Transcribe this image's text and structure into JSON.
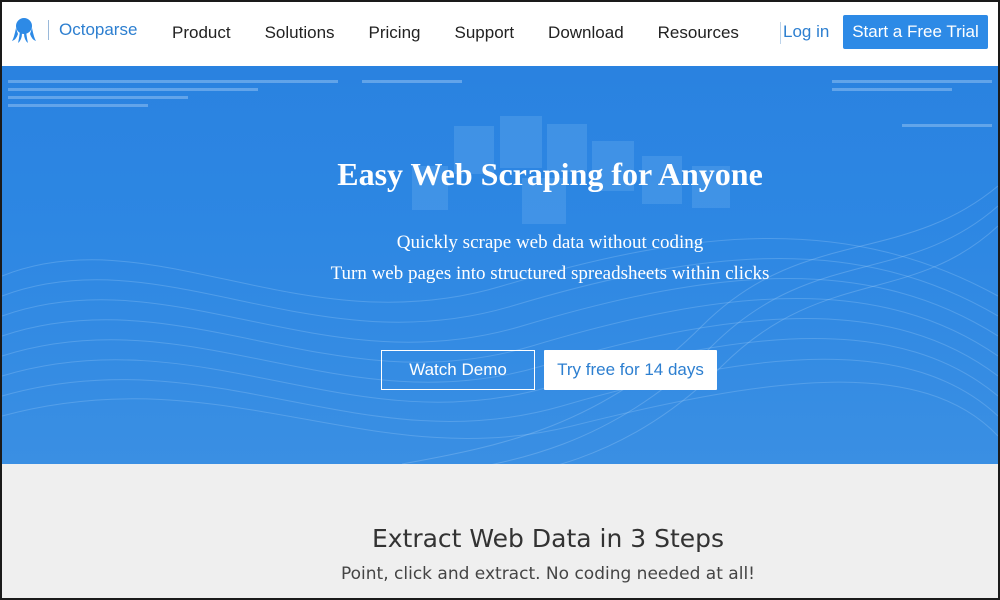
{
  "nav": {
    "logo_text": "Octoparse",
    "links": [
      {
        "label": "Product"
      },
      {
        "label": "Solutions"
      },
      {
        "label": "Pricing"
      },
      {
        "label": "Support"
      },
      {
        "label": "Download"
      },
      {
        "label": "Resources"
      }
    ],
    "login_label": "Log in",
    "trial_label": "Start a Free Trial"
  },
  "hero": {
    "title": "Easy Web Scraping for Anyone",
    "subtitle_line1": "Quickly scrape web data without coding",
    "subtitle_line2": "Turn web pages into structured spreadsheets within clicks",
    "demo_label": "Watch Demo",
    "try_label": "Try free for 14 days"
  },
  "steps": {
    "title": "Extract Web Data in 3 Steps",
    "subtitle": "Point, click and extract. No coding needed at all!"
  },
  "colors": {
    "accent": "#2d8ae6",
    "hero_blue": "#2a82e0",
    "link_blue": "#2d7fd0",
    "lower_bg": "#efefef"
  }
}
